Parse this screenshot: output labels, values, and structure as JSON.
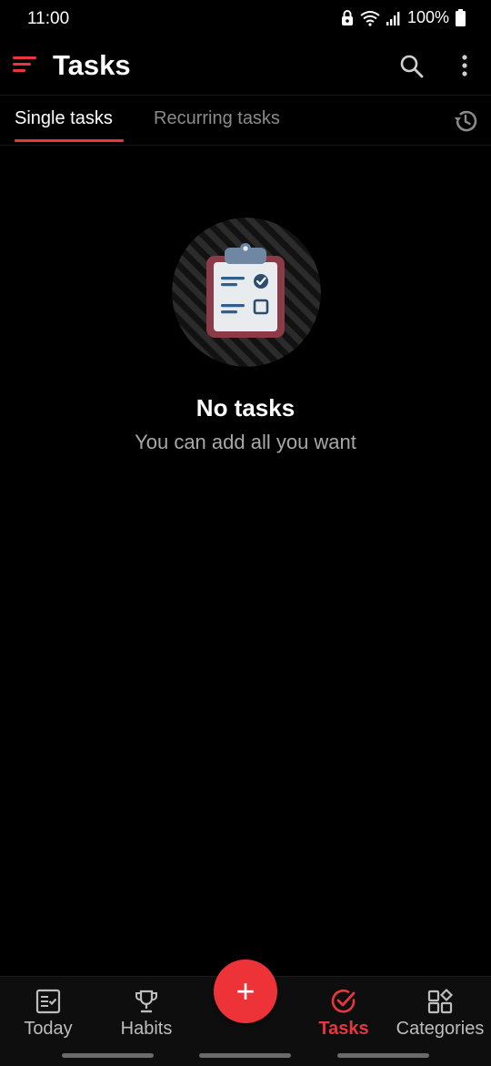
{
  "status_bar": {
    "time": "11:00",
    "battery": "100%",
    "icons": [
      "lock-icon",
      "wifi-icon",
      "signal-icon",
      "battery-icon"
    ]
  },
  "app_bar": {
    "title": "Tasks",
    "icons": [
      "menu-icon",
      "search-icon",
      "more-vert-icon"
    ]
  },
  "tabs": {
    "single": "Single tasks",
    "recurring": "Recurring tasks",
    "active": "single",
    "history_icon": "history-icon"
  },
  "empty_state": {
    "title": "No tasks",
    "subtitle": "You can add all you want",
    "illustration": "clipboard-checklist-icon"
  },
  "bottom_nav": {
    "items": [
      {
        "label": "Today",
        "icon": "calendar-check-icon"
      },
      {
        "label": "Habits",
        "icon": "trophy-icon"
      },
      {
        "label": "Tasks",
        "icon": "check-circle-icon",
        "active": true
      },
      {
        "label": "Categories",
        "icon": "categories-icon"
      }
    ],
    "fab": {
      "label": "+",
      "icon": "add-icon"
    }
  },
  "colors": {
    "accent": "#e8363b",
    "background": "#000000",
    "nav_background": "#0e0e0e",
    "inactive": "#8a8a8a"
  }
}
